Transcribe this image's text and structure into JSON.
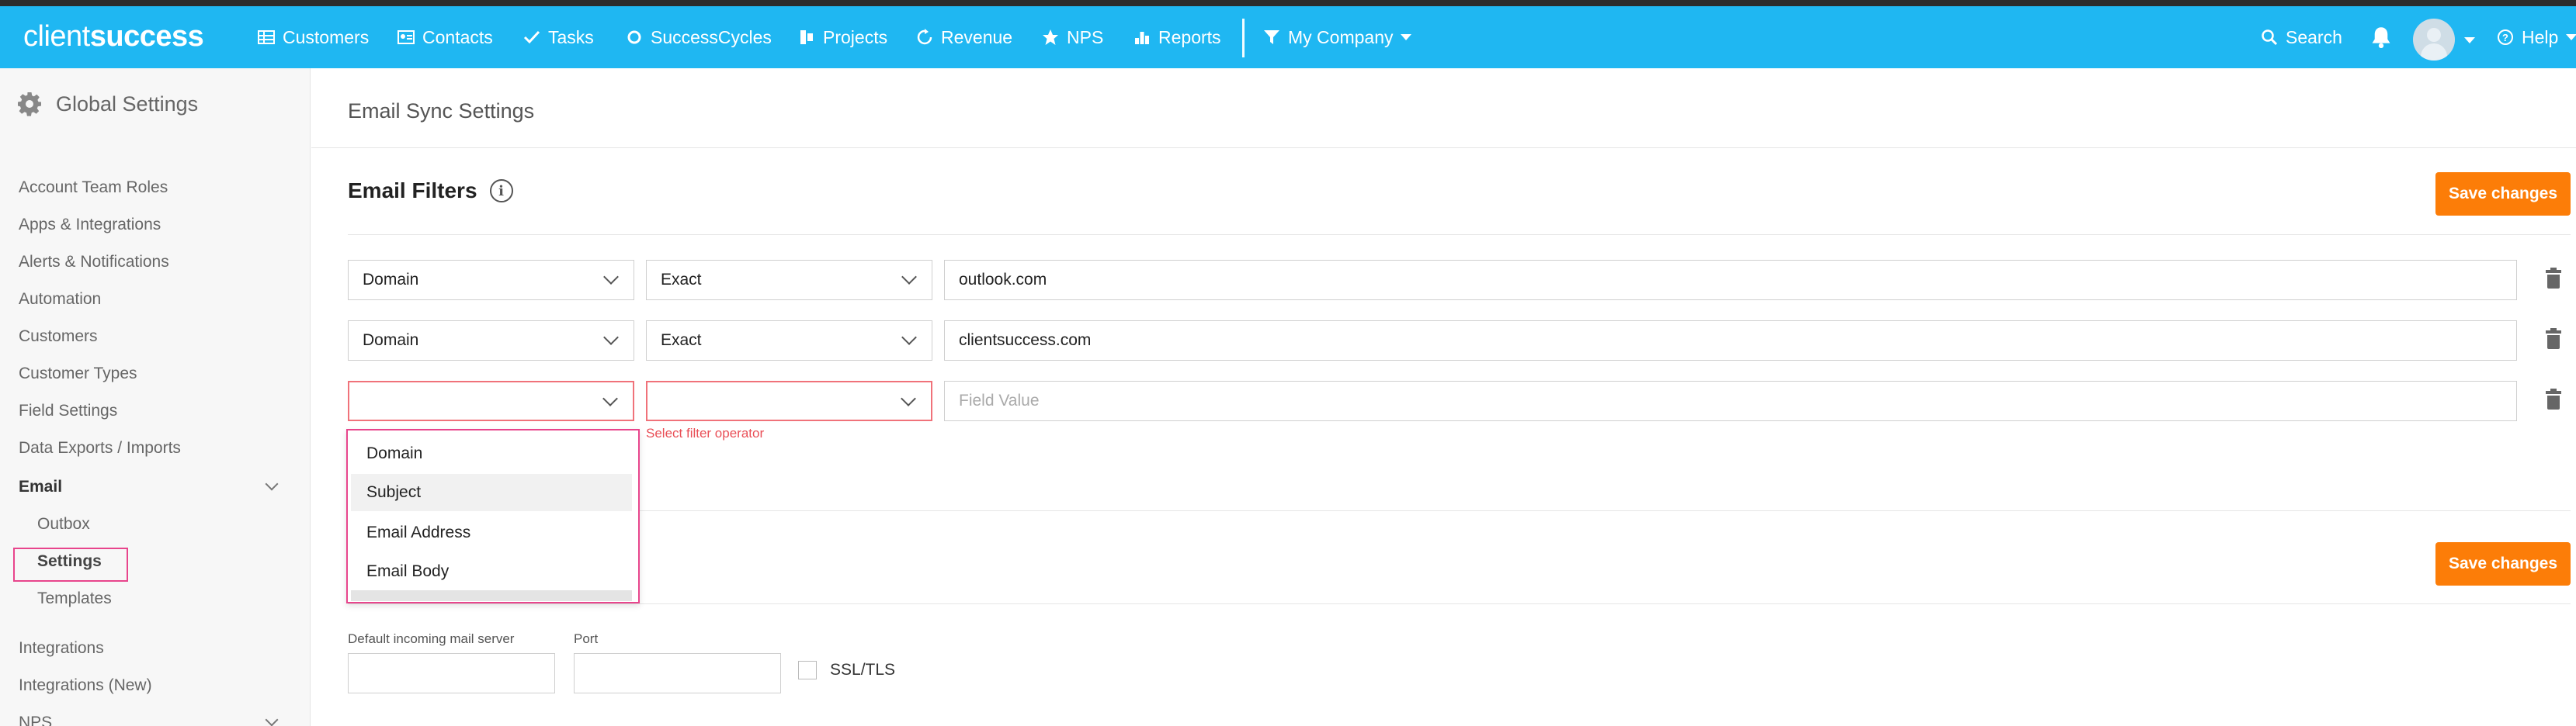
{
  "app": {
    "logo_light": "client",
    "logo_bold": "success"
  },
  "nav": {
    "items": [
      {
        "label": "Customers",
        "icon": "grid-icon"
      },
      {
        "label": "Contacts",
        "icon": "contact-card-icon"
      },
      {
        "label": "Tasks",
        "icon": "check-icon"
      },
      {
        "label": "SuccessCycles",
        "icon": "cycle-icon"
      },
      {
        "label": "Projects",
        "icon": "projects-icon"
      },
      {
        "label": "Revenue",
        "icon": "refresh-icon"
      },
      {
        "label": "NPS",
        "icon": "star-icon"
      },
      {
        "label": "Reports",
        "icon": "bar-chart-icon"
      }
    ],
    "company_filter": "My Company",
    "search": "Search",
    "help": "Help"
  },
  "sidebar": {
    "title": "Global Settings",
    "items": {
      "account_team_roles": "Account Team Roles",
      "apps_integrations": "Apps & Integrations",
      "alerts_notifications": "Alerts & Notifications",
      "automation": "Automation",
      "customers": "Customers",
      "customer_types": "Customer Types",
      "field_settings": "Field Settings",
      "data_exports": "Data Exports / Imports",
      "email": "Email",
      "outbox": "Outbox",
      "settings": "Settings",
      "templates": "Templates",
      "integrations": "Integrations",
      "integrations_new": "Integrations (New)",
      "nps": "NPS"
    }
  },
  "main": {
    "page_title": "Email Sync Settings",
    "filters_title": "Email Filters",
    "save_label": "Save changes",
    "filters": [
      {
        "field": "Domain",
        "operator": "Exact",
        "value": "outlook.com"
      },
      {
        "field": "Domain",
        "operator": "Exact",
        "value": " clientsuccess.com"
      },
      {
        "field": "",
        "operator": "",
        "value": ""
      }
    ],
    "value_placeholder": "Field Value",
    "operator_error": "Select filter operator",
    "dropdown_options": [
      "Domain",
      "Subject",
      "Email Address",
      "Email Body"
    ],
    "server": {
      "incoming_label": "Default incoming mail server",
      "port_label": "Port",
      "ssl_label": "SSL/TLS"
    }
  }
}
